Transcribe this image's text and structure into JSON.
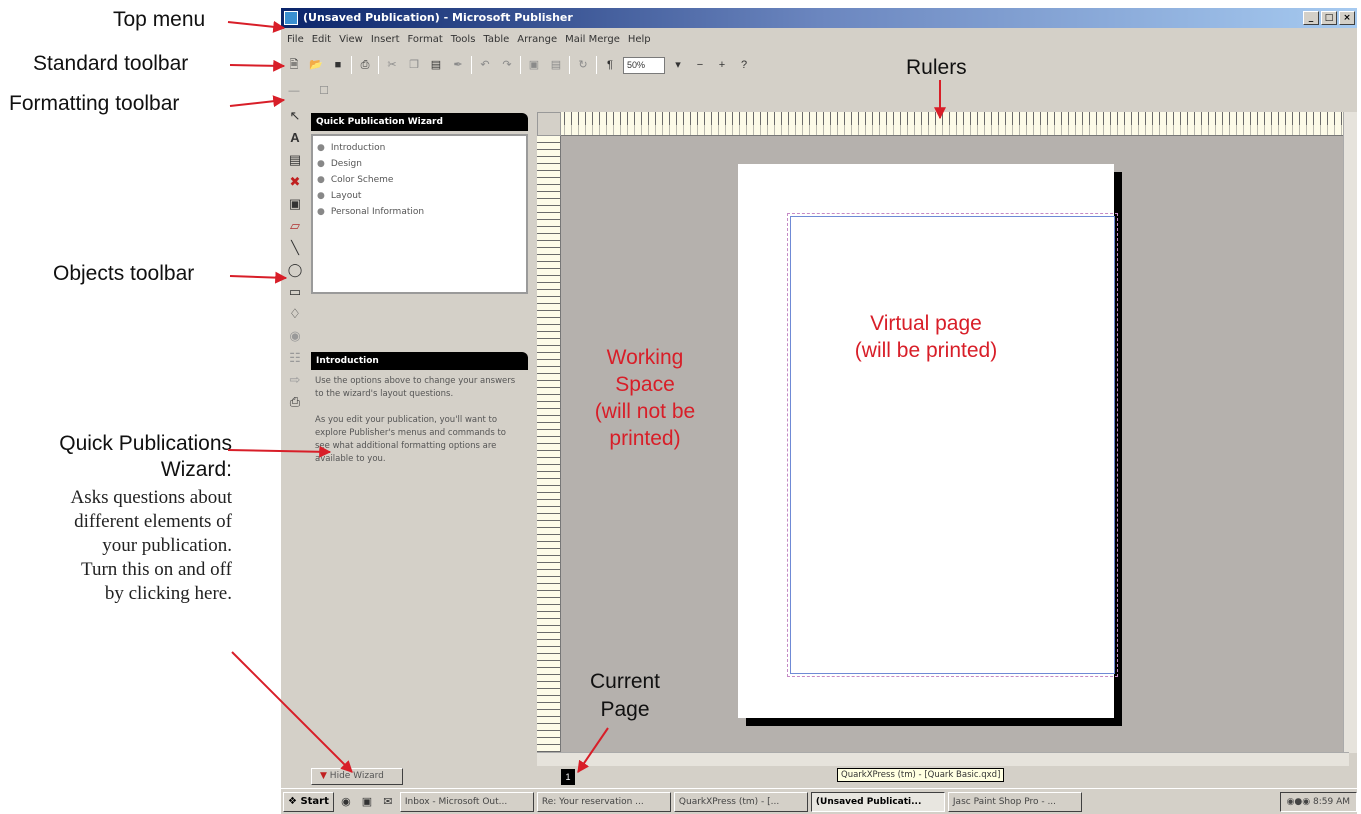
{
  "window": {
    "title": "(Unsaved Publication) - Microsoft Publisher",
    "controls": [
      "_",
      "□",
      "×"
    ]
  },
  "menu": [
    "File",
    "Edit",
    "View",
    "Insert",
    "Format",
    "Tools",
    "Table",
    "Arrange",
    "Mail Merge",
    "Help"
  ],
  "toolbar": {
    "zoom": "50%",
    "buttons": [
      "new-icon",
      "open-icon",
      "save-icon",
      "print-icon",
      "cut-icon",
      "copy-icon",
      "paste-icon",
      "format-painter-icon",
      "undo-icon",
      "redo-icon",
      "bring-forward-icon",
      "send-backward-icon",
      "rotate-icon",
      "pilcrow-icon",
      "zoom-out-icon",
      "zoom-in-icon",
      "help-icon"
    ]
  },
  "objects_toolbar": [
    "pointer-icon",
    "text-box-icon",
    "table-icon",
    "wordart-icon",
    "picture-icon",
    "clip-gallery-icon",
    "line-icon",
    "oval-icon",
    "rectangle-icon",
    "custom-shape-icon",
    "hot-spot-icon",
    "form-control-icon",
    "html-code-icon",
    "design-gallery-icon"
  ],
  "wizard": {
    "header": "Quick Publication Wizard",
    "items": [
      "Introduction",
      "Design",
      "Color Scheme",
      "Layout",
      "Personal Information"
    ],
    "intro_header": "Introduction",
    "intro_p1": "Use the options above to change your answers to the wizard's layout questions.",
    "intro_p2": "As you edit your publication, you'll want to explore Publisher's menus and commands to see what additional formatting options are available to you.",
    "hide_button": "Hide Wizard"
  },
  "status": {
    "page_number": "1",
    "tooltip": "QuarkXPress (tm) - [Quark Basic.qxd]"
  },
  "taskbar": {
    "start": "Start",
    "items": [
      "Inbox - Microsoft Out...",
      "Re: Your reservation ...",
      "QuarkXPress (tm) - [...",
      "(Unsaved Publicati...",
      "Jasc Paint Shop Pro - ..."
    ],
    "active_index": 3,
    "clock": "8:59 AM"
  },
  "annotations": {
    "top_menu": "Top menu",
    "standard_toolbar": "Standard toolbar",
    "formatting_toolbar": "Formatting toolbar",
    "objects_toolbar": "Objects toolbar",
    "rulers": "Rulers",
    "qpw_title_1": "Quick Publications",
    "qpw_title_2": "Wizard:",
    "qpw_desc_1": "Asks questions about",
    "qpw_desc_2": "different elements of",
    "qpw_desc_3": "your publication.",
    "qpw_desc_4": "Turn this on and off",
    "qpw_desc_5": "by clicking here.",
    "current_page_1": "Current",
    "current_page_2": "Page",
    "working_space_1": "Working",
    "working_space_2": "Space",
    "working_space_3": "(will not be",
    "working_space_4": "printed)",
    "virtual_page_1": "Virtual page",
    "virtual_page_2": "(will be printed)"
  },
  "colors": {
    "annotation_red": "#d81e28",
    "workspace_gray": "#b5b1ad",
    "title_blue": "#0a246a"
  }
}
